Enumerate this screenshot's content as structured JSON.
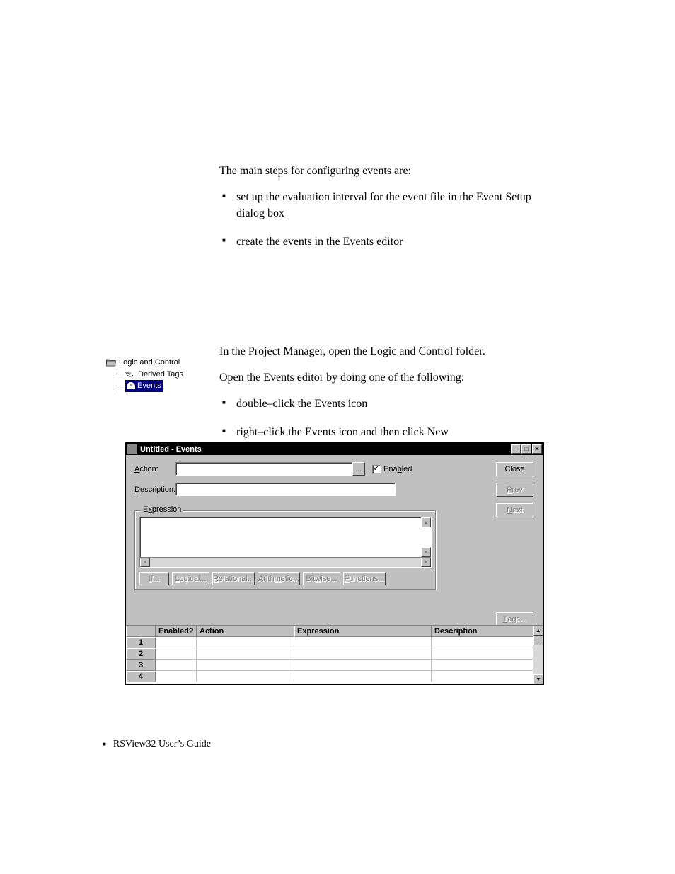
{
  "body": {
    "intro": "The main steps for configuring events are:",
    "b1": "set up the evaluation interval for the event file in the Event Setup dialog box",
    "b2": "create the events in the Events editor",
    "p1": "In the Project Manager, open the Logic and Control folder.",
    "p2": "Open the Events editor by doing one of the following:",
    "b3": "double–click the Events icon",
    "b4": "right–click the Events icon and then click New"
  },
  "tree": {
    "n1": "Logic and Control",
    "n2": "Derived Tags",
    "n3": "Events"
  },
  "win": {
    "title": "Untitled - Events",
    "labels": {
      "action_u": "A",
      "action_rest": "ction:",
      "desc_u": "D",
      "desc_rest": "escription:",
      "enabled_pre": "Ena",
      "enabled_u": "b",
      "enabled_rest": "led",
      "expr_pre": "E",
      "expr_u": "x",
      "expr_rest": "pression"
    },
    "buttons": {
      "close": "Close",
      "prev_u": "P",
      "prev_rest": "rev",
      "next_u": "N",
      "next_rest": "ext",
      "if_u": "I",
      "if_rest": "f...",
      "logical_u": "L",
      "logical_rest": "ogical...",
      "relational_u": "R",
      "relational_rest": "elational...",
      "arith_pre": "Arith",
      "arith_u": "m",
      "arith_rest": "etic...",
      "bitwise_pre": "Bit",
      "bitwise_u": "w",
      "bitwise_rest": "ise...",
      "functions_u": "F",
      "functions_rest": "unctions...",
      "tags_u": "T",
      "tags_rest": "ags...",
      "ellipsis": "..."
    },
    "grid": {
      "h_enabled": "Enabled?",
      "h_action": "Action",
      "h_expression": "Expression",
      "h_description": "Description",
      "rows": [
        "1",
        "2",
        "3",
        "4"
      ]
    },
    "chk_mark": "✓",
    "minimize": "−",
    "restore": "□",
    "close_x": "✕"
  },
  "footer": {
    "text": "RSView32  User’s Guide"
  }
}
